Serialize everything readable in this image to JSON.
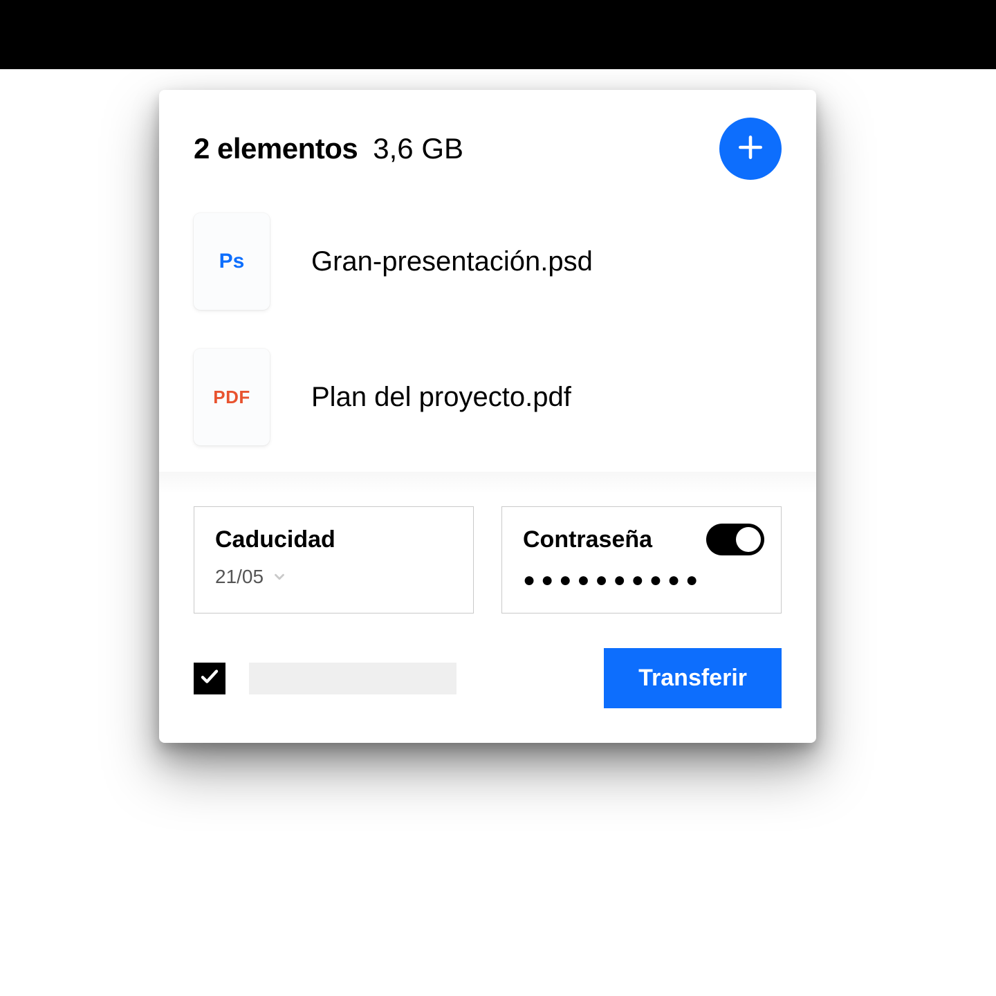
{
  "header": {
    "count_label": "2 elementos",
    "size_label": "3,6 GB"
  },
  "files": [
    {
      "icon_label": "Ps",
      "icon_class": "ps",
      "name": "Gran-presentación.psd"
    },
    {
      "icon_label": "PDF",
      "icon_class": "pdf",
      "name": "Plan del proyecto.pdf"
    }
  ],
  "expiry": {
    "title": "Caducidad",
    "date": "21/05"
  },
  "password": {
    "title": "Contraseña",
    "masked": "●●●●●●●●●●",
    "enabled": true
  },
  "actions": {
    "transfer_label": "Transferir"
  },
  "colors": {
    "accent": "#0d6efd"
  }
}
